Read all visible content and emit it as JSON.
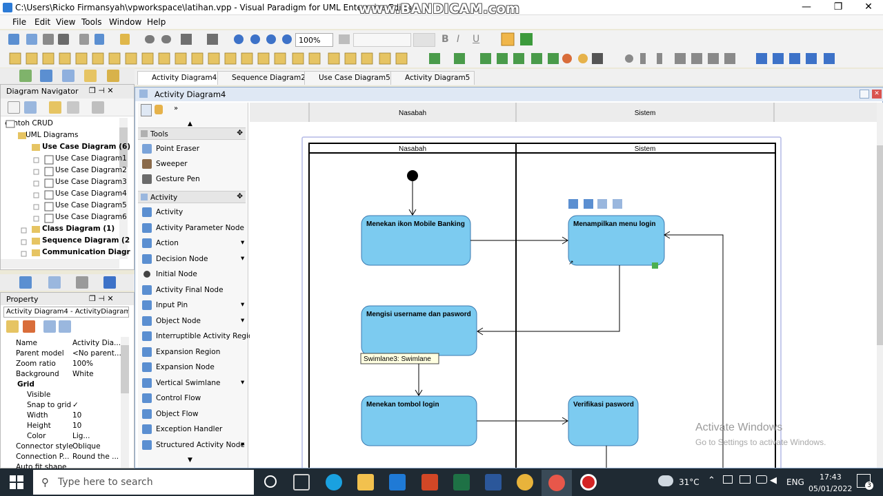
{
  "window": {
    "title": "C:\\Users\\Ricko Firmansyah\\vpworkspace\\latihan.vpp - Visual Paradigm for UML Enterprise Edition",
    "watermark": "www.BANDICAM.com",
    "minimize": "—",
    "maximize": "❐",
    "close": "✕"
  },
  "menu": [
    "File",
    "Edit",
    "View",
    "Tools",
    "Window",
    "Help"
  ],
  "toolbar": {
    "zoom": "100%",
    "bold": "B",
    "italic": "I",
    "underline": "U"
  },
  "tabs": [
    "Activity Diagram4",
    "Sequence Diagram2",
    "Use Case Diagram5",
    "Activity Diagram5"
  ],
  "navigator": {
    "title": "Diagram Navigator",
    "root": "contoh CRUD",
    "items": [
      "UML Diagrams",
      "Use Case Diagram (6)",
      "Use Case Diagram1",
      "Use Case Diagram2",
      "Use Case Diagram3",
      "Use Case Diagram4",
      "Use Case Diagram5",
      "Use Case Diagram6",
      "Class Diagram (1)",
      "Sequence Diagram (2",
      "Communication Diagr"
    ]
  },
  "property": {
    "title": "Property",
    "selector": "Activity Diagram4 - ActivityDiagram",
    "rows": [
      {
        "name": "Name",
        "value": "Activity Dia..."
      },
      {
        "name": "Parent model",
        "value": "<No parent..."
      },
      {
        "name": "Zoom ratio",
        "value": "100%"
      },
      {
        "name": "Background",
        "value": "White"
      },
      {
        "name": "Grid",
        "value": ""
      },
      {
        "name": "Visible",
        "value": ""
      },
      {
        "name": "Snap to grid",
        "value": "✓"
      },
      {
        "name": "Width",
        "value": "10"
      },
      {
        "name": "Height",
        "value": "10"
      },
      {
        "name": "Color",
        "value": "Lig..."
      },
      {
        "name": "Connector style",
        "value": "Oblique"
      },
      {
        "name": "Connection P...",
        "value": "Round the ..."
      },
      {
        "name": "Auto fit shape",
        "value": ""
      }
    ]
  },
  "diagram": {
    "title": "Activity Diagram4",
    "header_lanes": [
      "Nasabah",
      "Sistem"
    ],
    "lanes": [
      "Nasabah",
      "Sistem"
    ],
    "nodes": {
      "a1": "Menekan ikon Mobile Banking",
      "a2": "Menampilkan menu login",
      "a3": "Mengisi username dan pasword",
      "a4": "Menekan tombol login",
      "a5": "Verifikasi pasword"
    },
    "tooltip": "Swimlane3: Swimlane"
  },
  "palette": {
    "groups": {
      "tools": "Tools",
      "activity": "Activity"
    },
    "tools": [
      "Point Eraser",
      "Sweeper",
      "Gesture Pen"
    ],
    "activity": [
      "Activity",
      "Activity Parameter Node",
      "Action",
      "Decision Node",
      "Initial Node",
      "Activity Final Node",
      "Input Pin",
      "Object Node",
      "Interruptible Activity Region",
      "Expansion Region",
      "Expansion Node",
      "Vertical Swimlane",
      "Control Flow",
      "Object Flow",
      "Exception Handler",
      "Structured Activity Node"
    ]
  },
  "activate": {
    "line1": "Activate Windows",
    "line2": "Go to Settings to activate Windows."
  },
  "taskbar": {
    "search": "Type here to search",
    "temp": "31°C",
    "lang": "ENG",
    "time": "17:43",
    "date": "05/01/2022",
    "badge": "3"
  }
}
